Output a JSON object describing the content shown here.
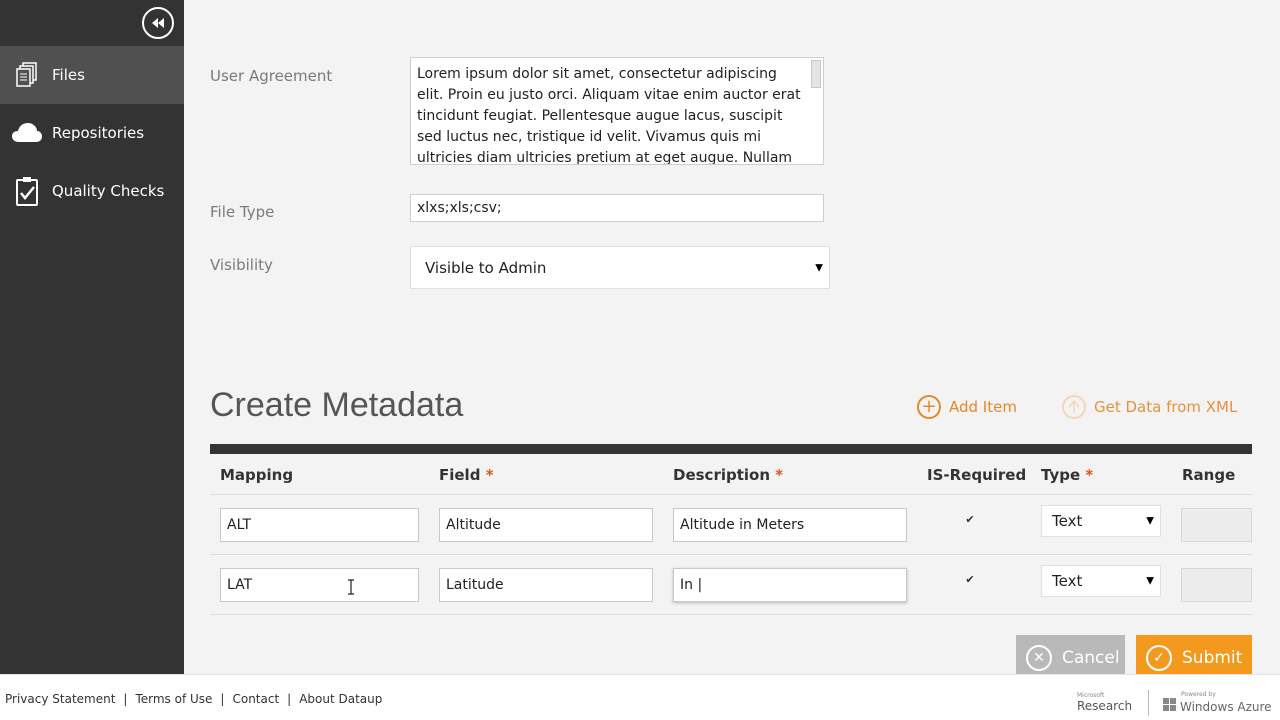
{
  "sidebar": {
    "items": [
      {
        "label": "Files",
        "icon": "files-icon",
        "active": true
      },
      {
        "label": "Repositories",
        "icon": "cloud-icon",
        "active": false
      },
      {
        "label": "Quality Checks",
        "icon": "clipboard-check-icon",
        "active": false
      }
    ]
  },
  "form": {
    "user_agreement_label": "User Agreement",
    "user_agreement_text": "Lorem ipsum dolor sit amet, consectetur adipiscing elit. Proin eu justo orci. Aliquam vitae enim auctor erat tincidunt feugiat. Pellentesque augue lacus, suscipit sed luctus nec, tristique id velit. Vivamus quis mi ultricies diam ultricies pretium at eget augue. Nullam blandit et",
    "file_type_label": "File Type",
    "file_type_value": "xlxs;xls;csv;",
    "visibility_label": "Visibility",
    "visibility_value": "Visible to Admin"
  },
  "metadata": {
    "title": "Create Metadata",
    "add_item": "Add Item",
    "get_xml": "Get Data from XML",
    "headers": {
      "mapping": "Mapping",
      "field": "Field",
      "description": "Description",
      "is_required": "IS-Required",
      "type": "Type",
      "range": "Range",
      "required_mark": "*"
    },
    "rows": [
      {
        "mapping": "ALT",
        "field": "Altitude",
        "description": "Altitude in Meters",
        "required": true,
        "type": "Text"
      },
      {
        "mapping": "LAT",
        "field": "Latitude",
        "description": "In |",
        "required": true,
        "type": "Text"
      }
    ]
  },
  "buttons": {
    "cancel": "Cancel",
    "submit": "Submit"
  },
  "footer": {
    "links": [
      "Privacy Statement",
      "Terms of Use",
      "Contact",
      "About Dataup"
    ],
    "ms_small": "Microsoft",
    "ms_big": "Research",
    "azure_small": "Powered by",
    "azure_big": "Windows Azure"
  },
  "colors": {
    "sidebar_bg": "#333333",
    "accent_orange": "#e8862a",
    "submit_bg": "#f39a1e",
    "cancel_bg": "#b9b9b9",
    "required_red": "#e0541a"
  }
}
